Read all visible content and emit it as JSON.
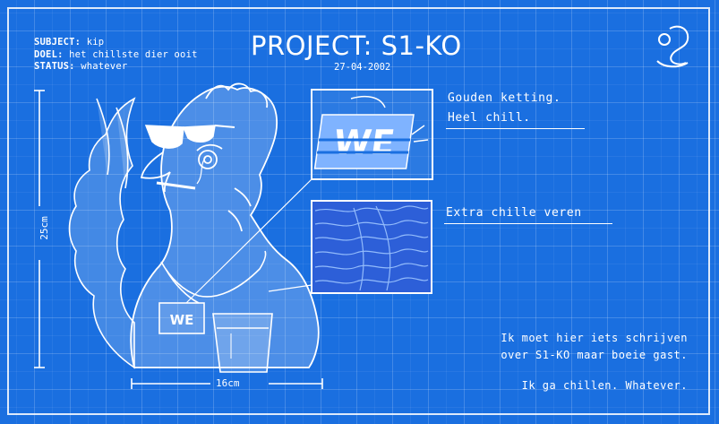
{
  "meta": {
    "subject_label": "SUBJECT:",
    "subject_value": "kip",
    "doel_label": "DOEL:",
    "doel_value": "het chillste dier ooit",
    "status_label": "STATUS:",
    "status_value": "whatever"
  },
  "header": {
    "title": "PROJECT: S1-KO",
    "date": "27-04-2002"
  },
  "dimensions": {
    "height": "25cm",
    "width": "16cm"
  },
  "callouts": {
    "chain_line1": "Gouden ketting.",
    "chain_line2": "Heel chill.",
    "feathers": "Extra chille veren",
    "pendant_text": "WE"
  },
  "footer": {
    "line1": "Ik moet hier iets schrijven",
    "line2": "over S1-KO maar boeie gast.",
    "line3": "Ik ga chillen. Whatever."
  },
  "colors": {
    "background": "#1a6fe0",
    "lines": "#ffffff"
  }
}
